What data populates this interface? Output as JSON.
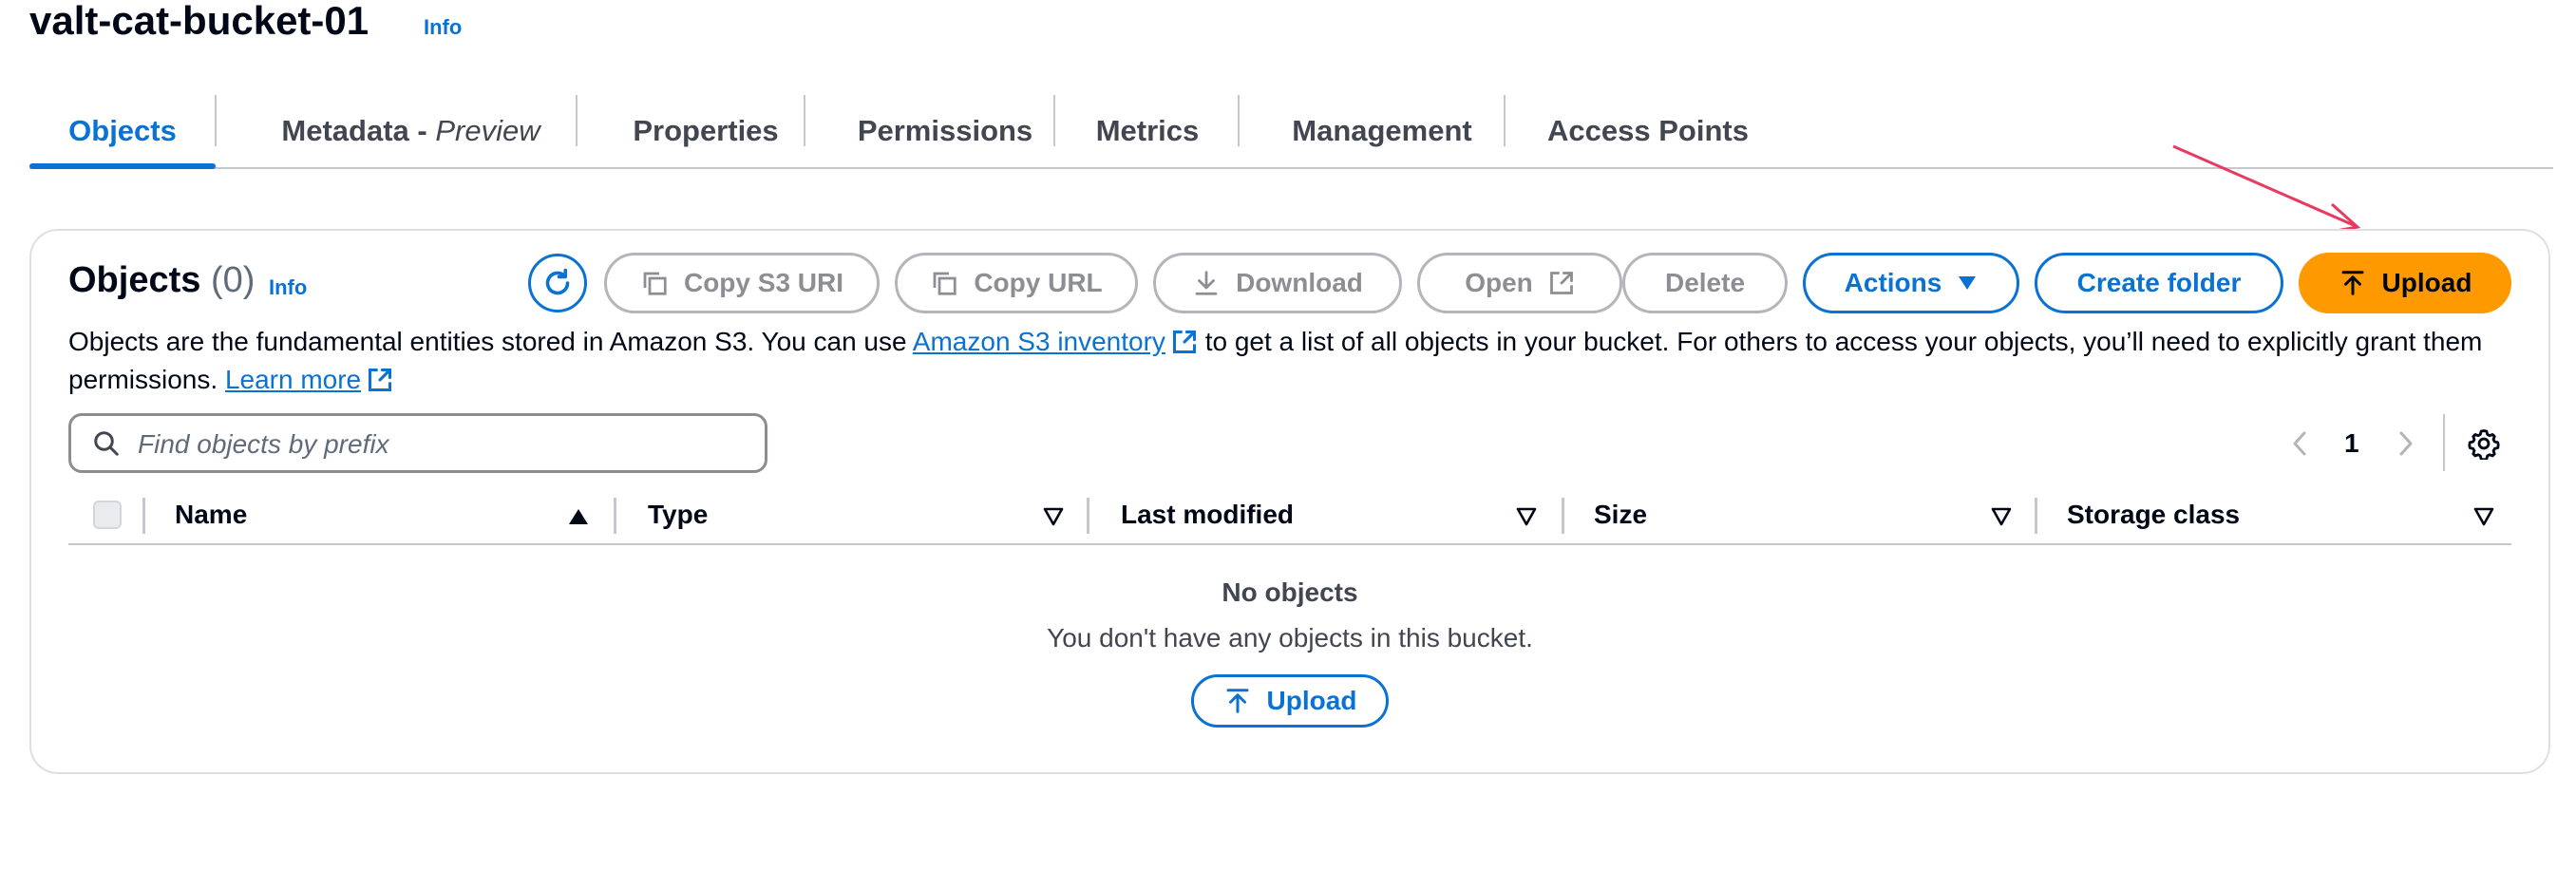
{
  "page": {
    "bucket_name": "valt-cat-bucket-01",
    "info_label": "Info"
  },
  "tabs": [
    {
      "label": "Objects",
      "active": true
    },
    {
      "label": "Metadata - ",
      "suffix": "Preview"
    },
    {
      "label": "Properties"
    },
    {
      "label": "Permissions"
    },
    {
      "label": "Metrics"
    },
    {
      "label": "Management"
    },
    {
      "label": "Access Points"
    }
  ],
  "objects_panel": {
    "title": "Objects",
    "count": "(0)",
    "info_label": "Info",
    "buttons": {
      "copy_s3_uri": "Copy S3 URI",
      "copy_url": "Copy URL",
      "download": "Download",
      "open": "Open",
      "delete": "Delete",
      "actions": "Actions",
      "create_folder": "Create folder",
      "upload": "Upload"
    },
    "description": {
      "part1": "Objects are the fundamental entities stored in Amazon S3. You can use ",
      "link1": "Amazon S3 inventory",
      "part2": " to get a list of all objects in your bucket. For others to access your objects, you’ll need to explicitly grant them permissions. ",
      "link2": "Learn more"
    },
    "search": {
      "placeholder": "Find objects by prefix",
      "value": ""
    },
    "pagination": {
      "current_page": "1"
    },
    "table": {
      "columns": [
        "Name",
        "Type",
        "Last modified",
        "Size",
        "Storage class"
      ],
      "sort": {
        "column": "Name",
        "direction": "ascending"
      }
    },
    "empty_state": {
      "title": "No objects",
      "message": "You don't have any objects in this bucket.",
      "upload_label": "Upload"
    }
  },
  "colors": {
    "accent": "#0972d3",
    "primary_button": "#ff9900",
    "annotation_arrow": "#e8395f"
  }
}
